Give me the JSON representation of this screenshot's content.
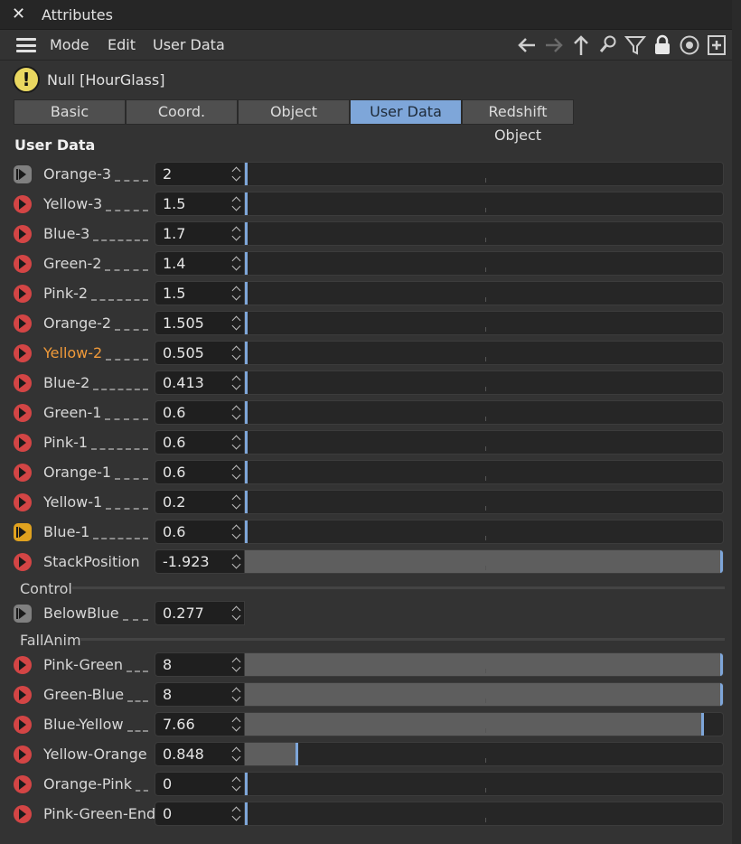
{
  "window": {
    "title": "Attributes",
    "close_glyph": "✕"
  },
  "menu": {
    "mode": "Mode",
    "edit": "Edit",
    "user_data": "User Data"
  },
  "toolbar_icons": [
    "back-arrow-icon",
    "forward-arrow-icon",
    "up-arrow-icon",
    "search-icon",
    "filter-icon",
    "lock-icon",
    "target-icon",
    "new-panel-icon"
  ],
  "object": {
    "warning_glyph": "!",
    "name": "Null [HourGlass]"
  },
  "tabs": [
    {
      "label": "Basic"
    },
    {
      "label": "Coord."
    },
    {
      "label": "Object"
    },
    {
      "label": "User Data",
      "active": true
    },
    {
      "label": "Redshift Object"
    }
  ],
  "section_title": "User Data",
  "user_data_rows": [
    {
      "label": "Orange-3",
      "value": "2",
      "slider": 0.0,
      "port": "grey"
    },
    {
      "label": "Yellow-3",
      "value": "1.5",
      "slider": 0.0,
      "port": "red"
    },
    {
      "label": "Blue-3",
      "value": "1.7",
      "slider": 0.0,
      "port": "red"
    },
    {
      "label": "Green-2",
      "value": "1.4",
      "slider": 0.0,
      "port": "red"
    },
    {
      "label": "Pink-2",
      "value": "1.5",
      "slider": 0.0,
      "port": "red"
    },
    {
      "label": "Orange-2",
      "value": "1.505",
      "slider": 0.0,
      "port": "red"
    },
    {
      "label": "Yellow-2",
      "value": "0.505",
      "slider": 0.0,
      "port": "red",
      "highlight": true
    },
    {
      "label": "Blue-2",
      "value": "0.413",
      "slider": 0.0,
      "port": "red"
    },
    {
      "label": "Green-1",
      "value": "0.6",
      "slider": 0.0,
      "port": "red"
    },
    {
      "label": "Pink-1",
      "value": "0.6",
      "slider": 0.0,
      "port": "red"
    },
    {
      "label": "Orange-1",
      "value": "0.6",
      "slider": 0.0,
      "port": "red"
    },
    {
      "label": "Yellow-1",
      "value": "0.2",
      "slider": 0.0,
      "port": "red"
    },
    {
      "label": "Blue-1",
      "value": "0.6",
      "slider": 0.0,
      "port": "orange"
    },
    {
      "label": "StackPosition",
      "value": "-1.923",
      "slider": 1.0,
      "port": "red"
    }
  ],
  "control_group": {
    "title": "Control",
    "rows": [
      {
        "label": "BelowBlue",
        "value": "0.277",
        "port": "grey",
        "no_slider": true
      }
    ]
  },
  "fallanim_group": {
    "title": "FallAnim",
    "rows": [
      {
        "label": "Pink-Green",
        "value": "8",
        "slider": 1.0,
        "port": "red"
      },
      {
        "label": "Green-Blue",
        "value": "8",
        "slider": 1.0,
        "port": "red"
      },
      {
        "label": "Blue-Yellow",
        "value": "7.66",
        "slider": 0.96,
        "port": "red"
      },
      {
        "label": "Yellow-Orange",
        "value": "0.848",
        "slider": 0.106,
        "port": "red"
      },
      {
        "label": "Orange-Pink",
        "value": "0",
        "slider": 0.0,
        "port": "red"
      },
      {
        "label": "Pink-Green-End",
        "value": "0",
        "slider": 0.0,
        "port": "red"
      }
    ]
  }
}
